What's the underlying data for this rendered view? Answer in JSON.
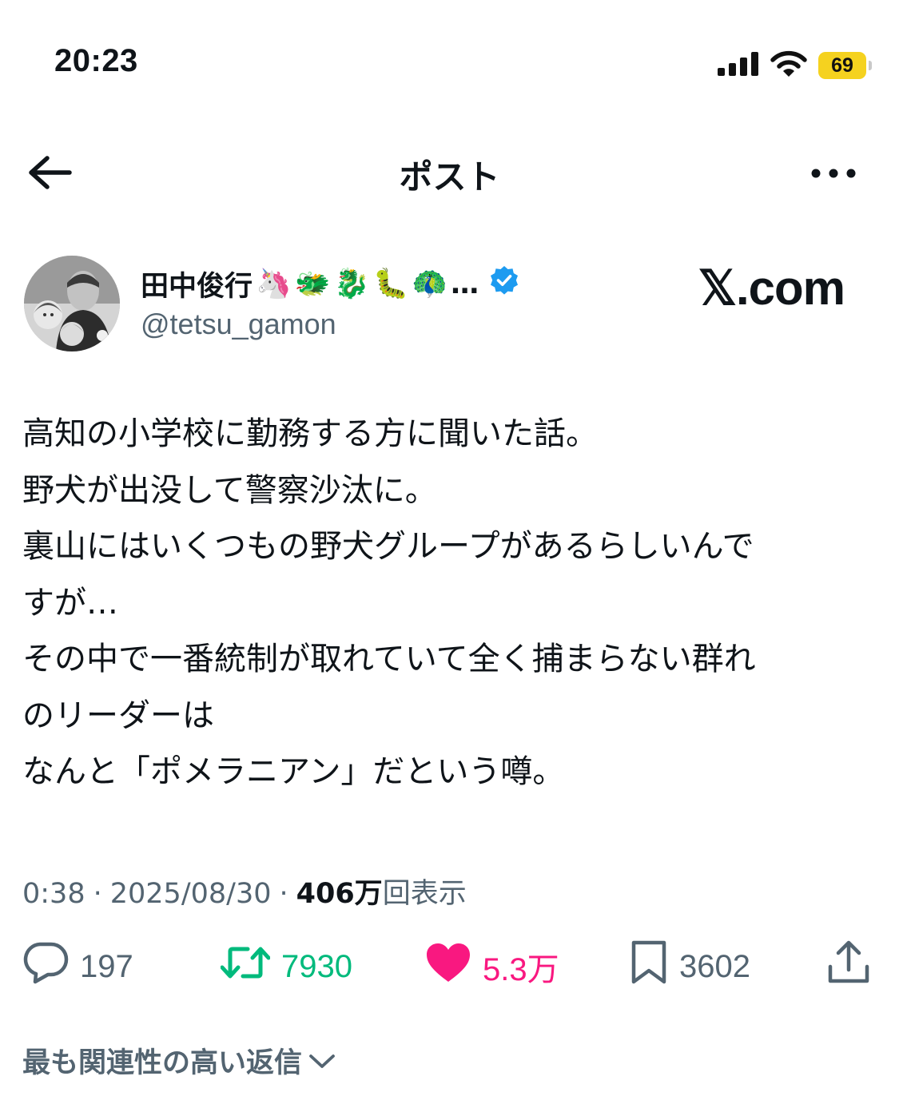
{
  "status_bar": {
    "time": "20:23",
    "battery": "69",
    "icons": [
      "signal-icon",
      "wifi-icon",
      "battery-icon"
    ]
  },
  "header": {
    "title": "ポスト",
    "back_icon": "arrow-left-icon",
    "more_icon": "more-horizontal-icon"
  },
  "author": {
    "name": "田中俊行",
    "name_emojis": [
      "🦄",
      "🐲",
      "🐉",
      "🐛",
      "🦚"
    ],
    "name_ellipsis": "…",
    "handle": "@tetsu_gamon",
    "verified": true
  },
  "watermark": "𝕏.com",
  "post": {
    "lines": [
      "高知の小学校に勤務する方に聞いた話。",
      "野犬が出没して警察沙汰に。",
      "裏山にはいくつもの野犬グループがあるらしいんで",
      "すが…",
      "その中で一番統制が取れていて全く捕まらない群れ",
      "のリーダーは",
      "なんと「ポメラニアン」だという噂。"
    ]
  },
  "meta": {
    "time": "0:38",
    "separator": "·",
    "date": "2025/08/30",
    "views_count": "406万",
    "views_label": "回表示"
  },
  "actions": {
    "replies": "197",
    "retweets": "7930",
    "likes": "5.3万",
    "bookmarks": "3602"
  },
  "colors": {
    "retweet": "#00ba7c",
    "like": "#f91880",
    "verified": "#1d9bf0",
    "battery": "#f5d21f",
    "secondary_text": "#536471"
  },
  "replies_sort": {
    "label": "最も関連性の高い返信"
  }
}
